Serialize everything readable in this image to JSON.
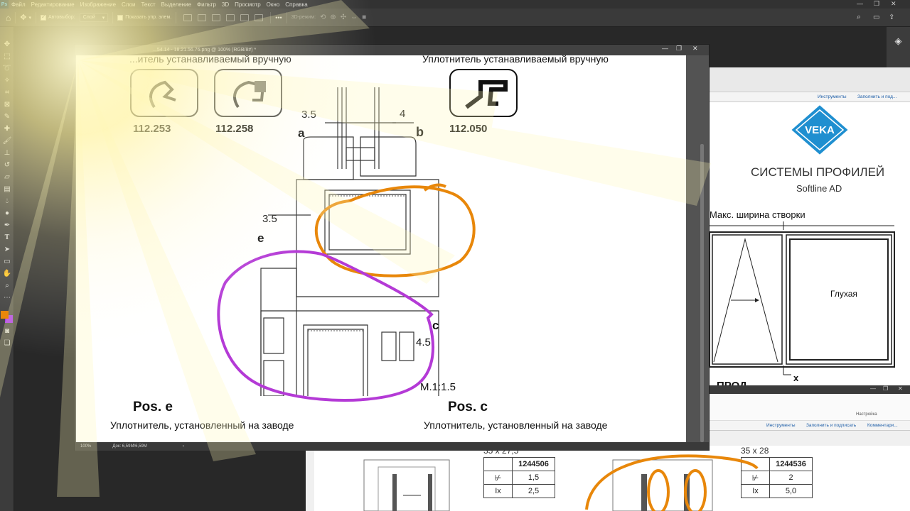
{
  "menubar": {
    "logo": "Ps",
    "items": [
      "Файл",
      "Редактирование",
      "Изображение",
      "Слои",
      "Текст",
      "Выделение",
      "Фильтр",
      "3D",
      "Просмотр",
      "Окно",
      "Справка"
    ]
  },
  "options": {
    "autoselect_label": "Автовыбор:",
    "autoselect_value": "Слой",
    "show_controls_label": "Показать упр. элем.",
    "mode_3d_label": "3D-режим:",
    "more": "•••"
  },
  "document": {
    "title": "...54.14 - 18.21.56.76.png @ 100% (RGB/8#) *",
    "zoom": "100%",
    "doc_info": "Док: 6,59M/6,59M",
    "labels": {
      "top_left_caption": "...итель устанавливаемый вручную",
      "top_right_caption": "Уплотнитель устанавливаемый вручную",
      "part1": "112.253",
      "part2": "112.258",
      "part3": "112.050",
      "dim1": "3.5",
      "dim2": "4",
      "dim3": "3.5",
      "dim4": "4.5",
      "letter_a": "a",
      "letter_b": "b",
      "letter_e": "e",
      "letter_c": "c",
      "scale": "M.1:1.5",
      "pos_e": "Pos. e",
      "pos_c": "Pos. c",
      "bottom_left_caption": "Уплотнитель, установленный на заводе",
      "bottom_right_caption": "Уплотнитель, установленный на заводе"
    }
  },
  "pdf_right": {
    "tools": "Инструменты",
    "fill_sign": "Заполнить и под...",
    "brand": "VEKA",
    "heading": "СИСТЕМЫ ПРОФИЛЕЙ",
    "subheading": "Softline AD",
    "max_width_label": "Макс. ширина створки",
    "fixed_label": "Глухая",
    "x_label": "x",
    "cut_text": "ПРОД..."
  },
  "pdf_bottom": {
    "settings": "Настройка",
    "tools": "Инструменты",
    "fill_sign": "Заполнить и подписать",
    "comments": "Комментари...",
    "left_dims": "35 x 27,5",
    "right_dims": "35 x 28",
    "left_table": {
      "code": "1244506",
      "row1": "1,5",
      "row2": "2,5",
      "row2_label": "Ix"
    },
    "right_table": {
      "code": "1244536",
      "row1": "2",
      "row2": "5,0",
      "row2_label": "Ix"
    }
  },
  "colors": {
    "orange_annotation": "#e8870a",
    "purple_annotation": "#b43ad6",
    "veka_blue": "#1f8fd0",
    "foreground_swatch": "#e8870a",
    "background_swatch": "#a020f0"
  }
}
